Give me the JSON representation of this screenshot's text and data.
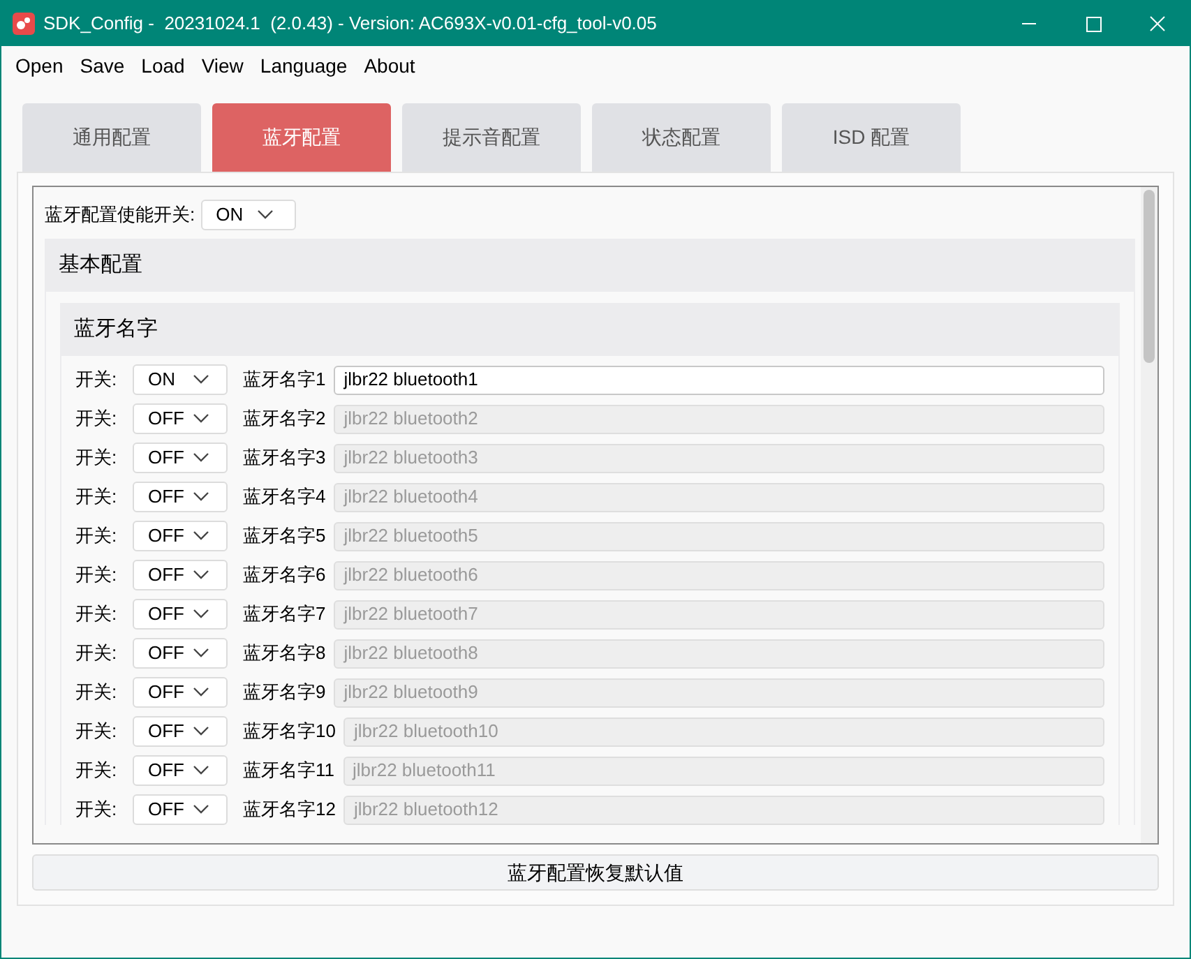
{
  "window": {
    "title": "SDK_Config -  20231024.1  (2.0.43) - Version: AC693X-v0.01-cfg_tool-v0.05"
  },
  "menu": [
    "Open",
    "Save",
    "Load",
    "View",
    "Language",
    "About"
  ],
  "tabs": [
    {
      "label": "通用配置",
      "selected": false
    },
    {
      "label": "蓝牙配置",
      "selected": true
    },
    {
      "label": "提示音配置",
      "selected": false
    },
    {
      "label": "状态配置",
      "selected": false
    },
    {
      "label": "ISD 配置",
      "selected": false
    }
  ],
  "enable": {
    "label": "蓝牙配置使能开关:",
    "value": "ON"
  },
  "section": {
    "title": "基本配置",
    "group": {
      "title": "蓝牙名字",
      "rows": [
        {
          "switch_label": "开关:",
          "switch": "ON",
          "label": "蓝牙名字1",
          "value": "jlbr22 bluetooth1",
          "enabled": true
        },
        {
          "switch_label": "开关:",
          "switch": "OFF",
          "label": "蓝牙名字2",
          "value": "jlbr22 bluetooth2",
          "enabled": false
        },
        {
          "switch_label": "开关:",
          "switch": "OFF",
          "label": "蓝牙名字3",
          "value": "jlbr22 bluetooth3",
          "enabled": false
        },
        {
          "switch_label": "开关:",
          "switch": "OFF",
          "label": "蓝牙名字4",
          "value": "jlbr22 bluetooth4",
          "enabled": false
        },
        {
          "switch_label": "开关:",
          "switch": "OFF",
          "label": "蓝牙名字5",
          "value": "jlbr22 bluetooth5",
          "enabled": false
        },
        {
          "switch_label": "开关:",
          "switch": "OFF",
          "label": "蓝牙名字6",
          "value": "jlbr22 bluetooth6",
          "enabled": false
        },
        {
          "switch_label": "开关:",
          "switch": "OFF",
          "label": "蓝牙名字7",
          "value": "jlbr22 bluetooth7",
          "enabled": false
        },
        {
          "switch_label": "开关:",
          "switch": "OFF",
          "label": "蓝牙名字8",
          "value": "jlbr22 bluetooth8",
          "enabled": false
        },
        {
          "switch_label": "开关:",
          "switch": "OFF",
          "label": "蓝牙名字9",
          "value": "jlbr22 bluetooth9",
          "enabled": false
        },
        {
          "switch_label": "开关:",
          "switch": "OFF",
          "label": "蓝牙名字10",
          "value": "jlbr22 bluetooth10",
          "enabled": false
        },
        {
          "switch_label": "开关:",
          "switch": "OFF",
          "label": "蓝牙名字11",
          "value": "jlbr22 bluetooth11",
          "enabled": false
        },
        {
          "switch_label": "开关:",
          "switch": "OFF",
          "label": "蓝牙名字12",
          "value": "jlbr22 bluetooth12",
          "enabled": false
        }
      ]
    }
  },
  "reset_button": "蓝牙配置恢复默认值"
}
